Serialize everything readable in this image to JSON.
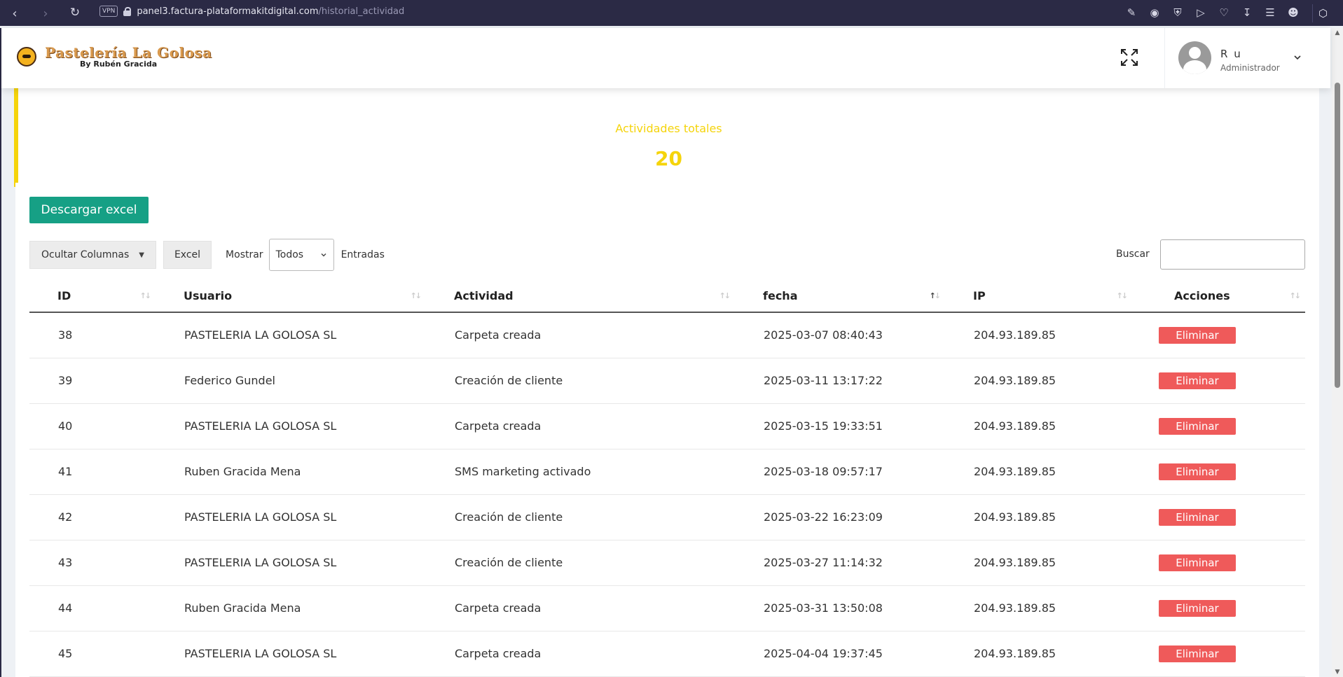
{
  "browser": {
    "vpn": "VPN",
    "url_host": "panel3.factura-plataformakitdigital.com",
    "url_path": "/historial_actividad"
  },
  "header": {
    "logo_title": "Pastelería La Golosa",
    "logo_subtitle": "By Rubén Gracida",
    "user_name": "R u",
    "user_role": "Administrador"
  },
  "stats": {
    "label": "Actividades totales",
    "value": "20"
  },
  "toolbar": {
    "download_excel": "Descargar excel",
    "hide_columns": "Ocultar Columnas",
    "excel": "Excel",
    "show_label": "Mostrar",
    "show_value": "Todos",
    "entries_label": "Entradas",
    "search_label": "Buscar",
    "search_value": ""
  },
  "table": {
    "columns": [
      "ID",
      "Usuario",
      "Actividad",
      "fecha",
      "IP",
      "Acciones"
    ],
    "rows": [
      {
        "id": "38",
        "usuario": "PASTELERIA LA GOLOSA SL",
        "actividad": "Carpeta creada",
        "fecha": "2025-03-07 08:40:43",
        "ip": "204.93.189.85",
        "accion": "Eliminar"
      },
      {
        "id": "39",
        "usuario": "Federico Gundel",
        "actividad": "Creación de cliente",
        "fecha": "2025-03-11 13:17:22",
        "ip": "204.93.189.85",
        "accion": "Eliminar"
      },
      {
        "id": "40",
        "usuario": "PASTELERIA LA GOLOSA SL",
        "actividad": "Carpeta creada",
        "fecha": "2025-03-15 19:33:51",
        "ip": "204.93.189.85",
        "accion": "Eliminar"
      },
      {
        "id": "41",
        "usuario": "Ruben Gracida Mena",
        "actividad": "SMS marketing activado",
        "fecha": "2025-03-18 09:57:17",
        "ip": "204.93.189.85",
        "accion": "Eliminar"
      },
      {
        "id": "42",
        "usuario": "PASTELERIA LA GOLOSA SL",
        "actividad": "Creación de cliente",
        "fecha": "2025-03-22 16:23:09",
        "ip": "204.93.189.85",
        "accion": "Eliminar"
      },
      {
        "id": "43",
        "usuario": "PASTELERIA LA GOLOSA SL",
        "actividad": "Creación de cliente",
        "fecha": "2025-03-27 11:14:32",
        "ip": "204.93.189.85",
        "accion": "Eliminar"
      },
      {
        "id": "44",
        "usuario": "Ruben Gracida Mena",
        "actividad": "Carpeta creada",
        "fecha": "2025-03-31 13:50:08",
        "ip": "204.93.189.85",
        "accion": "Eliminar"
      },
      {
        "id": "45",
        "usuario": "PASTELERIA LA GOLOSA SL",
        "actividad": "Carpeta creada",
        "fecha": "2025-04-04 19:37:45",
        "ip": "204.93.189.85",
        "accion": "Eliminar"
      }
    ]
  },
  "colors": {
    "accent_yellow": "#f5d40b",
    "excel_green": "#16a085",
    "delete_red": "#ef5a5a",
    "browser_bar": "#2b2a45"
  }
}
